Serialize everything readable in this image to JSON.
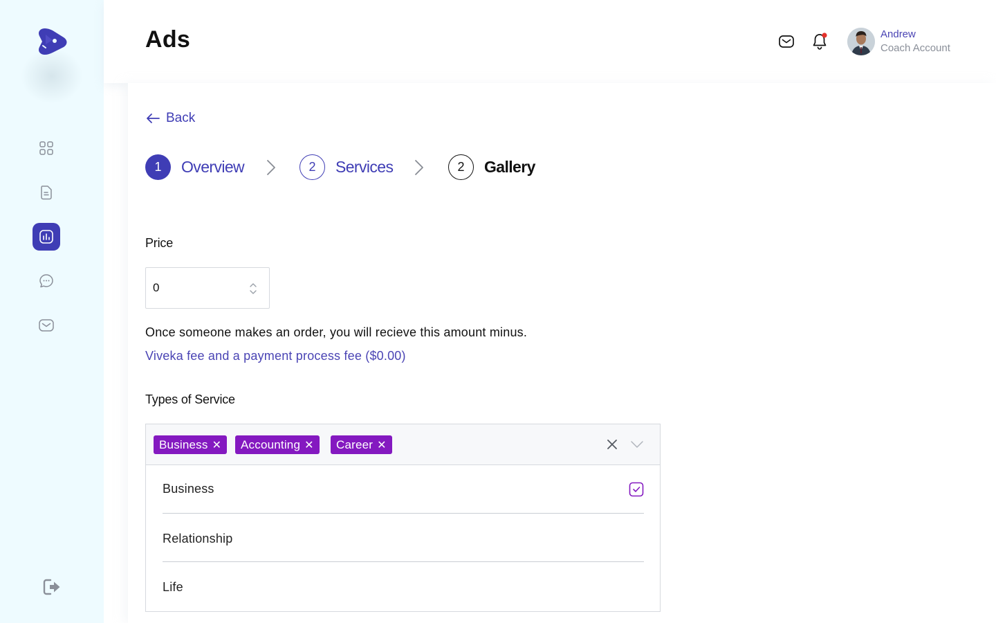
{
  "header": {
    "title": "Ads",
    "user": {
      "name": "Andrew",
      "role": "Coach Account"
    }
  },
  "nav": {
    "back_label": "Back"
  },
  "steps": [
    {
      "number": "1",
      "label": "Overview",
      "state": "active"
    },
    {
      "number": "2",
      "label": "Services",
      "state": "upcoming"
    },
    {
      "number": "2",
      "label": "Gallery",
      "state": "current-outline"
    }
  ],
  "price": {
    "label": "Price",
    "value": "0",
    "info": "Once someone makes an order, you will recieve this amount minus.",
    "fee_link": "Viveka fee and a payment process fee ($0.00)"
  },
  "service_types": {
    "label": "Types of Service",
    "selected_tags": [
      "Business",
      "Accounting",
      "Career"
    ],
    "options": [
      {
        "label": "Business",
        "checked": true
      },
      {
        "label": "Relationship",
        "checked": false
      },
      {
        "label": "Life",
        "checked": false
      }
    ]
  },
  "colors": {
    "accent": "#3f3db5",
    "tag": "#8419c0",
    "sidebar_bg": "#eefbff",
    "notification_dot": "#e5312b"
  },
  "icons": {
    "sidebar": [
      "dashboard-grid-icon",
      "document-icon",
      "analytics-icon",
      "chat-icon",
      "mail-icon"
    ],
    "header": [
      "mail-icon",
      "bell-icon"
    ],
    "logout": "logout-icon"
  }
}
